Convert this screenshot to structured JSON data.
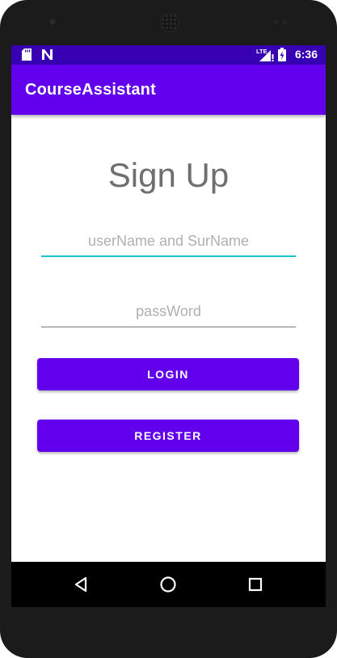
{
  "status_bar": {
    "time": "6:36",
    "network_label": "LTE",
    "icons": [
      "sd-card-icon",
      "notification-n-icon",
      "lte-signal-icon",
      "battery-charging-icon"
    ]
  },
  "app_bar": {
    "title": "CourseAssistant"
  },
  "form": {
    "heading": "Sign Up",
    "username": {
      "value": "",
      "placeholder": "userName and SurName"
    },
    "password": {
      "value": "",
      "placeholder": "passWord"
    },
    "login_label": "LOGIN",
    "register_label": "REGISTER"
  },
  "nav_bar": {
    "icons": [
      "back-icon",
      "home-icon",
      "recents-icon"
    ]
  },
  "colors": {
    "primary": "#6200ee",
    "primary_dark": "#3700b3",
    "focus_underline": "#18c3c9"
  }
}
